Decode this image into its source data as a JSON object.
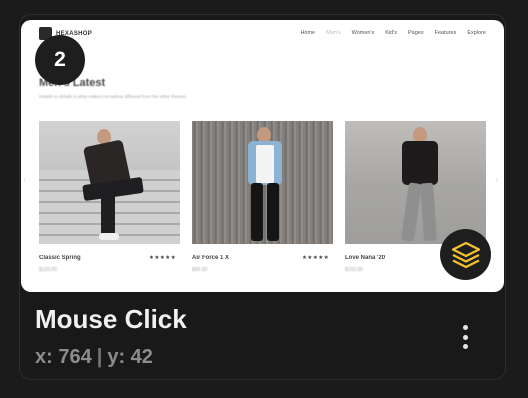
{
  "step": {
    "number": "2"
  },
  "screenshot": {
    "site_name": "HEXASHOP",
    "nav": [
      "Home",
      "Men's",
      "Women's",
      "Kid's",
      "Pages",
      "Features",
      "Explore"
    ],
    "active_nav": "Men's",
    "section_title": "Men's Latest",
    "section_subtitle": "Details to details is what makes Hexashop different from the other themes.",
    "products": [
      {
        "name": "Classic Spring",
        "stars": "★★★★★",
        "price": "$120.00"
      },
      {
        "name": "Air Force 1 X",
        "stars": "★★★★★",
        "price": "$90.00"
      },
      {
        "name": "Love Nana '20",
        "stars": "",
        "price": "$150.00"
      }
    ]
  },
  "action": {
    "title": "Mouse Click",
    "x_label": "x: 764",
    "separator": "|",
    "y_label": "y: 42"
  },
  "icons": {
    "layers": "layers-icon",
    "more": "more-vertical-icon"
  },
  "colors": {
    "accent": "#f4c12f",
    "background": "#1c1b1b",
    "title": "#f1f1f1",
    "coords": "#8c8c8c"
  }
}
